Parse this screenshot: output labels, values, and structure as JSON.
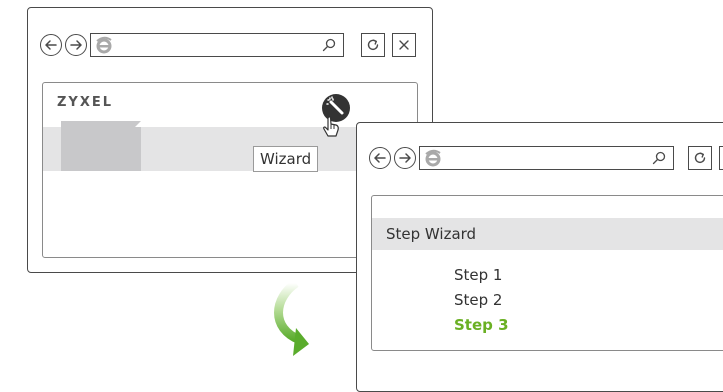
{
  "window1": {
    "logo": "ZYXEL",
    "tooltip": "Wizard"
  },
  "window2": {
    "panel_title": "Step Wizard",
    "steps": [
      {
        "label": "Step 1",
        "active": false
      },
      {
        "label": "Step 2",
        "active": false
      },
      {
        "label": "Step 3",
        "active": true
      }
    ]
  },
  "colors": {
    "active_step": "#6ab023",
    "arrow_green": "#5aac2c",
    "band_grey": "#e4e4e5",
    "border": "#4a4a4a"
  },
  "icons": [
    "back-arrow-icon",
    "forward-arrow-icon",
    "ie-logo-icon",
    "search-icon",
    "refresh-icon",
    "close-icon",
    "wizard-wand-icon",
    "hand-cursor-icon",
    "curved-arrow-icon"
  ]
}
